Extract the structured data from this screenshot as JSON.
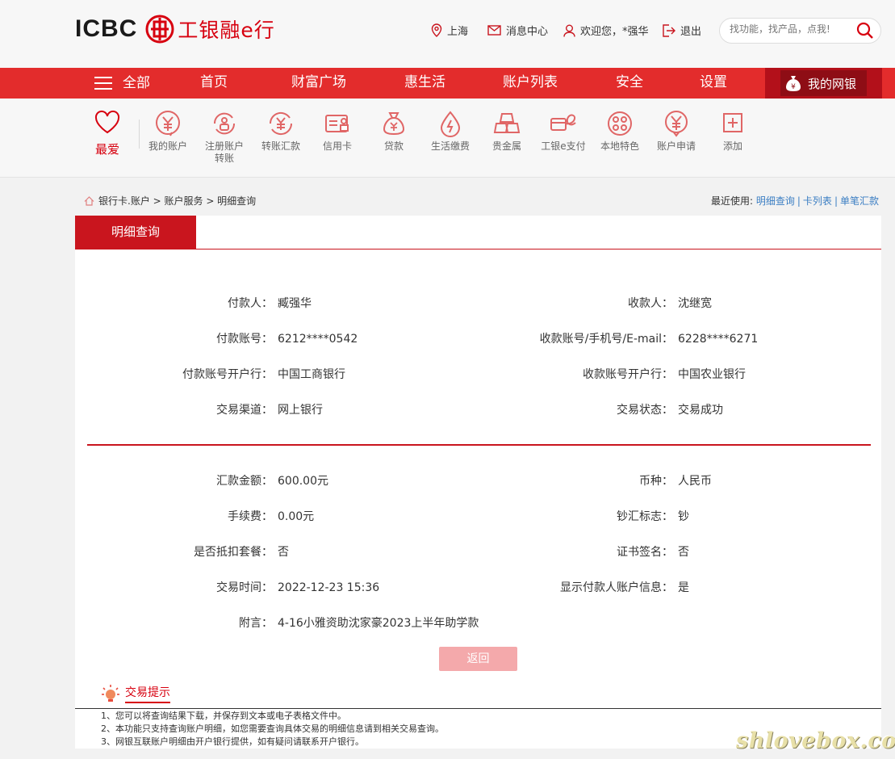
{
  "header": {
    "logo_en": "ICBC",
    "logo_cn": "工银融e行",
    "location": "上海",
    "messages": "消息中心",
    "welcome": "欢迎您，*强华",
    "logout": "退出",
    "search_placeholder": "找功能，找产品，点我!"
  },
  "nav": {
    "all": "全部",
    "items": [
      "首页",
      "财富广场",
      "惠生活",
      "账户列表",
      "安全",
      "设置"
    ],
    "mine": "我的网银"
  },
  "quick": {
    "fav": "最爱",
    "items": [
      {
        "label": "我的账户",
        "icon": "yen-circle-icon"
      },
      {
        "label": "注册账户转账",
        "icon": "register-transfer-icon"
      },
      {
        "label": "转账汇款",
        "icon": "transfer-icon"
      },
      {
        "label": "信用卡",
        "icon": "credit-card-icon"
      },
      {
        "label": "贷款",
        "icon": "loan-bag-icon"
      },
      {
        "label": "生活缴费",
        "icon": "utility-drop-icon"
      },
      {
        "label": "贵金属",
        "icon": "gold-bars-icon"
      },
      {
        "label": "工银e支付",
        "icon": "e-pay-icon"
      },
      {
        "label": "本地特色",
        "icon": "local-dots-icon"
      },
      {
        "label": "账户申请",
        "icon": "account-apply-icon"
      },
      {
        "label": "添加",
        "icon": "add-icon"
      }
    ]
  },
  "breadcrumb": {
    "path": "银行卡.账户 > 账户服务 > 明细查询",
    "recent_label": "最近使用:",
    "recent": [
      "明细查询",
      "卡列表",
      "单笔汇款"
    ]
  },
  "page": {
    "tab": "明细查询",
    "fields_top": {
      "payer_label": "付款人：",
      "payer": "臧强华",
      "payee_label": "收款人：",
      "payee": "沈继宽",
      "payer_acct_label": "付款账号：",
      "payer_acct": "6212****0542",
      "payee_acct_label": "收款账号/手机号/E-mail：",
      "payee_acct": "6228****6271",
      "payer_bank_label": "付款账号开户行：",
      "payer_bank": "中国工商银行",
      "payee_bank_label": "收款账号开户行：",
      "payee_bank": "中国农业银行",
      "channel_label": "交易渠道：",
      "channel": "网上银行",
      "status_label": "交易状态：",
      "status": "交易成功"
    },
    "fields_bottom": {
      "amount_label": "汇款金额：",
      "amount": "600.00元",
      "currency_label": "币种：",
      "currency": "人民币",
      "fee_label": "手续费：",
      "fee": "0.00元",
      "cash_label": "钞汇标志：",
      "cash": "钞",
      "package_label": "是否抵扣套餐：",
      "package": "否",
      "cert_label": "证书签名：",
      "cert": "否",
      "time_label": "交易时间：",
      "time": "2022-12-23 15:36",
      "show_payer_label": "显示付款人账户信息：",
      "show_payer": "是",
      "memo_label": "附言：",
      "memo": "4-16小雅资助沈家豪2023上半年助学款"
    },
    "back_button": "返回"
  },
  "tips": {
    "title": "交易提示",
    "lines": [
      "1、您可以将查询结果下载，并保存到文本或电子表格文件中。",
      "2、本功能只支持查询账户明细，如您需要查询具体交易的明细信息请到相关交易查询。",
      "3、网银互联账户明细由开户银行提供，如有疑问请联系开户银行。"
    ]
  },
  "watermark": "shlovebox.com",
  "colors": {
    "brand_red": "#e32c2c",
    "dark_red": "#c9151e",
    "link_blue": "#3b7ec3"
  }
}
